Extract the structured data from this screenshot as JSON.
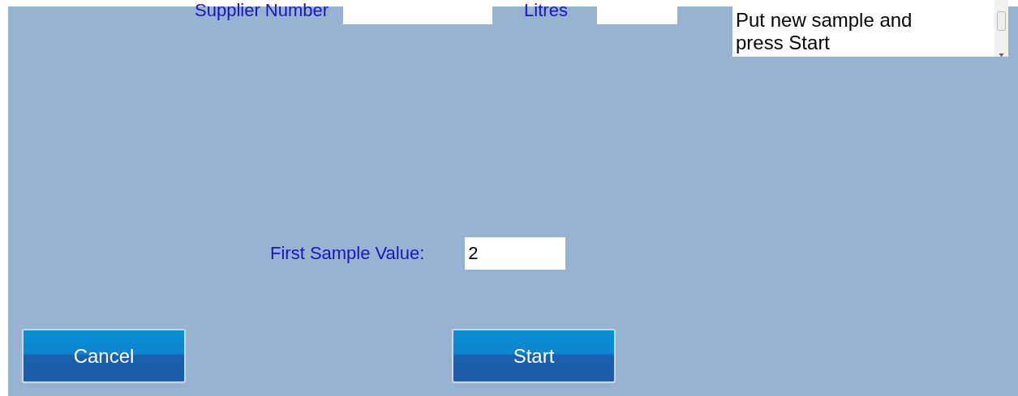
{
  "header": {
    "supplier_label": "Supplier Number",
    "litres_label": "Litres"
  },
  "message": "Put new sample and press Start",
  "first_sample": {
    "label": "First Sample Value:",
    "value": "2"
  },
  "buttons": [
    {
      "label": "Cancel"
    },
    {
      "label": "Start"
    }
  ]
}
